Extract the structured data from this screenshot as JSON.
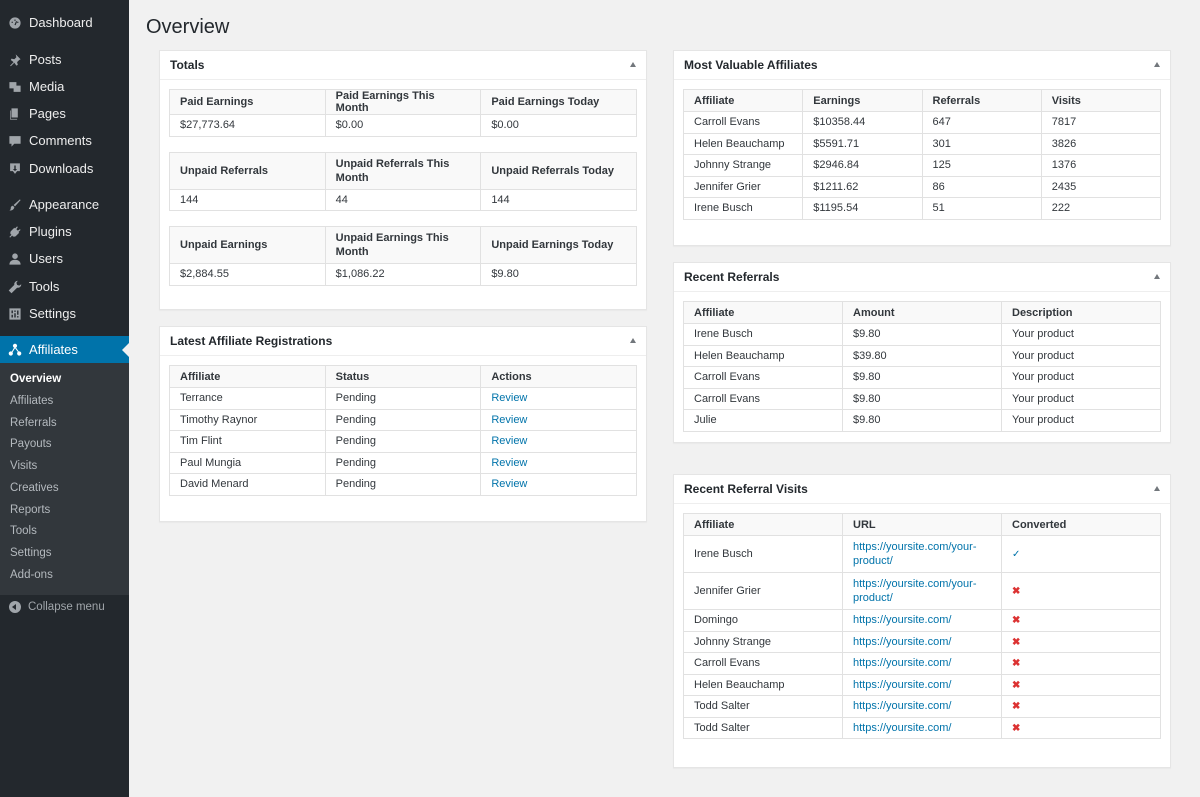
{
  "page": {
    "title": "Overview"
  },
  "sidebar": {
    "items": [
      {
        "label": "Dashboard",
        "icon": "dashboard-icon"
      },
      {
        "label": "Posts",
        "icon": "pin-icon"
      },
      {
        "label": "Media",
        "icon": "media-icon"
      },
      {
        "label": "Pages",
        "icon": "pages-icon"
      },
      {
        "label": "Comments",
        "icon": "comment-icon"
      },
      {
        "label": "Downloads",
        "icon": "download-icon"
      },
      {
        "label": "Appearance",
        "icon": "brush-icon"
      },
      {
        "label": "Plugins",
        "icon": "plug-icon"
      },
      {
        "label": "Users",
        "icon": "user-icon"
      },
      {
        "label": "Tools",
        "icon": "wrench-icon"
      },
      {
        "label": "Settings",
        "icon": "sliders-icon"
      },
      {
        "label": "Affiliates",
        "icon": "affiliate-network-icon"
      }
    ],
    "submenu": [
      "Overview",
      "Affiliates",
      "Referrals",
      "Payouts",
      "Visits",
      "Creatives",
      "Reports",
      "Tools",
      "Settings",
      "Add-ons"
    ],
    "collapse_label": "Collapse menu",
    "active_color": "#0073aa"
  },
  "totals": {
    "title": "Totals",
    "tables": [
      {
        "headers": [
          "Paid Earnings",
          "Paid Earnings This Month",
          "Paid Earnings Today"
        ],
        "values": [
          "$27,773.64",
          "$0.00",
          "$0.00"
        ]
      },
      {
        "headers": [
          "Unpaid Referrals",
          "Unpaid Referrals This Month",
          "Unpaid Referrals Today"
        ],
        "values": [
          "144",
          "44",
          "144"
        ]
      },
      {
        "headers": [
          "Unpaid Earnings",
          "Unpaid Earnings This Month",
          "Unpaid Earnings Today"
        ],
        "values": [
          "$2,884.55",
          "$1,086.22",
          "$9.80"
        ]
      }
    ]
  },
  "latest_registrations": {
    "title": "Latest Affiliate Registrations",
    "headers": [
      "Affiliate",
      "Status",
      "Actions"
    ],
    "rows": [
      [
        "Terrance",
        "Pending",
        "Review"
      ],
      [
        "Timothy Raynor",
        "Pending",
        "Review"
      ],
      [
        "Tim Flint",
        "Pending",
        "Review"
      ],
      [
        "Paul Mungia",
        "Pending",
        "Review"
      ],
      [
        "David Menard",
        "Pending",
        "Review"
      ]
    ]
  },
  "most_valuable": {
    "title": "Most Valuable Affiliates",
    "headers": [
      "Affiliate",
      "Earnings",
      "Referrals",
      "Visits"
    ],
    "rows": [
      [
        "Carroll Evans",
        "$10358.44",
        "647",
        "7817"
      ],
      [
        "Helen Beauchamp",
        "$5591.71",
        "301",
        "3826"
      ],
      [
        "Johnny Strange",
        "$2946.84",
        "125",
        "1376"
      ],
      [
        "Jennifer Grier",
        "$1211.62",
        "86",
        "2435"
      ],
      [
        "Irene Busch",
        "$1195.54",
        "51",
        "222"
      ]
    ]
  },
  "recent_referrals": {
    "title": "Recent Referrals",
    "headers": [
      "Affiliate",
      "Amount",
      "Description"
    ],
    "rows": [
      [
        "Irene Busch",
        "$9.80",
        "Your product"
      ],
      [
        "Helen Beauchamp",
        "$39.80",
        "Your product"
      ],
      [
        "Carroll Evans",
        "$9.80",
        "Your product"
      ],
      [
        "Carroll Evans",
        "$9.80",
        "Your product"
      ],
      [
        "Julie",
        "$9.80",
        "Your product"
      ]
    ]
  },
  "recent_visits": {
    "title": "Recent Referral Visits",
    "headers": [
      "Affiliate",
      "URL",
      "Converted"
    ],
    "rows": [
      {
        "affiliate": "Irene Busch",
        "url": "https://yoursite.com/your-product/",
        "converted": true,
        "converted_glyph": "✓"
      },
      {
        "affiliate": "Jennifer Grier",
        "url": "https://yoursite.com/your-product/",
        "converted": false,
        "converted_glyph": "✖"
      },
      {
        "affiliate": "Domingo",
        "url": "https://yoursite.com/",
        "converted": false,
        "converted_glyph": "✖"
      },
      {
        "affiliate": "Johnny Strange",
        "url": "https://yoursite.com/",
        "converted": false,
        "converted_glyph": "✖"
      },
      {
        "affiliate": "Carroll Evans",
        "url": "https://yoursite.com/",
        "converted": false,
        "converted_glyph": "✖"
      },
      {
        "affiliate": "Helen Beauchamp",
        "url": "https://yoursite.com/",
        "converted": false,
        "converted_glyph": "✖"
      },
      {
        "affiliate": "Todd Salter",
        "url": "https://yoursite.com/",
        "converted": false,
        "converted_glyph": "✖"
      },
      {
        "affiliate": "Todd Salter",
        "url": "https://yoursite.com/",
        "converted": false,
        "converted_glyph": "✖"
      }
    ]
  }
}
